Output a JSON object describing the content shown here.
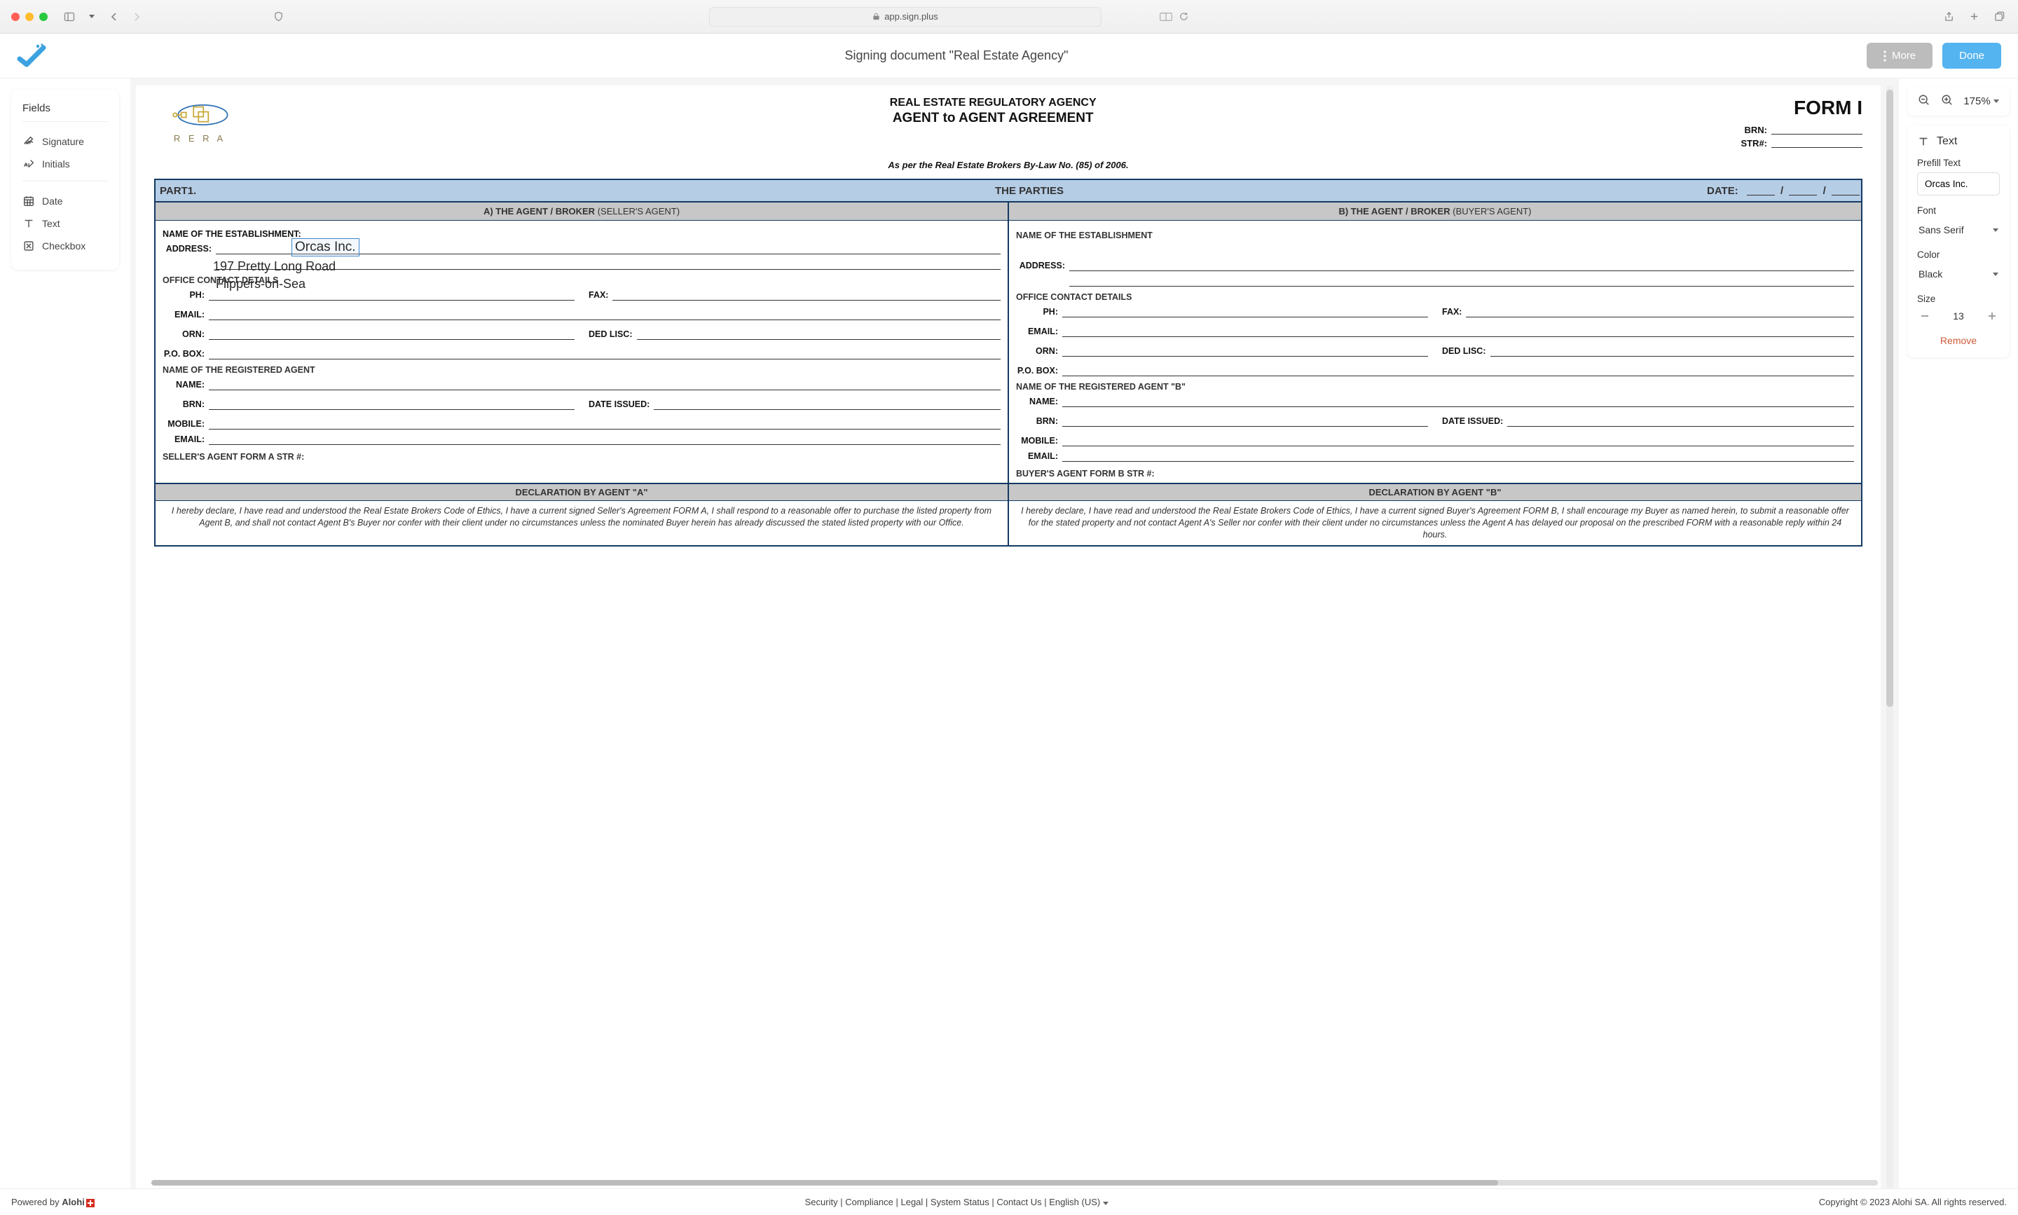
{
  "browser": {
    "url": "app.sign.plus"
  },
  "header": {
    "title": "Signing document \"Real Estate Agency\"",
    "more": "More",
    "done": "Done"
  },
  "left": {
    "heading": "Fields",
    "items": [
      "Signature",
      "Initials",
      "Date",
      "Text",
      "Checkbox"
    ]
  },
  "zoom": {
    "value": "175%"
  },
  "props": {
    "section": "Text",
    "prefill_label": "Prefill Text",
    "prefill_value": "Orcas Inc.",
    "font_label": "Font",
    "font_value": "Sans Serif",
    "color_label": "Color",
    "color_value": "Black",
    "size_label": "Size",
    "size_value": "13",
    "remove": "Remove"
  },
  "doc": {
    "title1": "REAL ESTATE REGULATORY AGENCY",
    "title2": "AGENT to AGENT AGREEMENT",
    "form": "FORM I",
    "brn": "BRN:",
    "str": "STR#:",
    "bylaw": "As per the Real Estate Brokers By-Law No. (85) of 2006.",
    "part1": "PART1.",
    "parties": "THE PARTIES",
    "date": "DATE:",
    "colA": "A) THE AGENT / BROKER",
    "colA_sub": "(SELLER'S AGENT)",
    "colB": "B) THE AGENT / BROKER",
    "colB_sub": "(BUYER'S AGENT)",
    "estA": "NAME OF THE ESTABLISHMENT:",
    "estB": "NAME OF THE ESTABLISHMENT",
    "address": "ADDRESS:",
    "office": "OFFICE CONTACT DETAILS",
    "ph": "PH:",
    "fax": "FAX:",
    "email": "EMAIL:",
    "orn": "ORN:",
    "ded": "DED LISC:",
    "po": "P.O. BOX:",
    "regA": "NAME OF THE REGISTERED AGENT",
    "regB": "NAME OF THE REGISTERED AGENT \"B\"",
    "name": "NAME:",
    "brn2": "BRN:",
    "issued": "DATE ISSUED:",
    "mobile": "MOBILE:",
    "email2": "EMAIL:",
    "strA": "SELLER'S AGENT FORM A STR #:",
    "strB": "BUYER'S AGENT FORM B STR #:",
    "declA": "DECLARATION BY AGENT \"A\"",
    "declB": "DECLARATION BY AGENT \"B\"",
    "declA_txt": "I hereby declare, I have read and understood the Real Estate Brokers Code of Ethics, I have a current signed Seller's Agreement FORM A, I shall respond to a reasonable offer to purchase the listed property from Agent B, and shall not contact Agent B's Buyer nor confer with their client under no circumstances unless the nominated Buyer herein has already discussed the stated listed property with our Office.",
    "declB_txt": "I hereby declare, I have read and understood the Real Estate Brokers Code of Ethics, I have a current signed Buyer's Agreement FORM B, I shall encourage my Buyer as named herein, to submit a reasonable offer for the stated property and not contact Agent A's Seller nor confer with their client under no circumstances unless the Agent A has delayed our proposal on the prescribed FORM with a reasonable reply within 24 hours.",
    "overlay_est": "Orcas Inc.",
    "overlay_addr1": "197  Pretty Long Road",
    "overlay_addr2": "Flippers-on-Sea",
    "rera": "R E R A"
  },
  "footer": {
    "powered": "Powered by ",
    "alohi": "Alohi",
    "links": [
      "Security",
      "Compliance",
      "Legal",
      "System Status",
      "Contact Us",
      "English (US)"
    ],
    "copyright": "Copyright © 2023 Alohi SA. All rights reserved."
  }
}
